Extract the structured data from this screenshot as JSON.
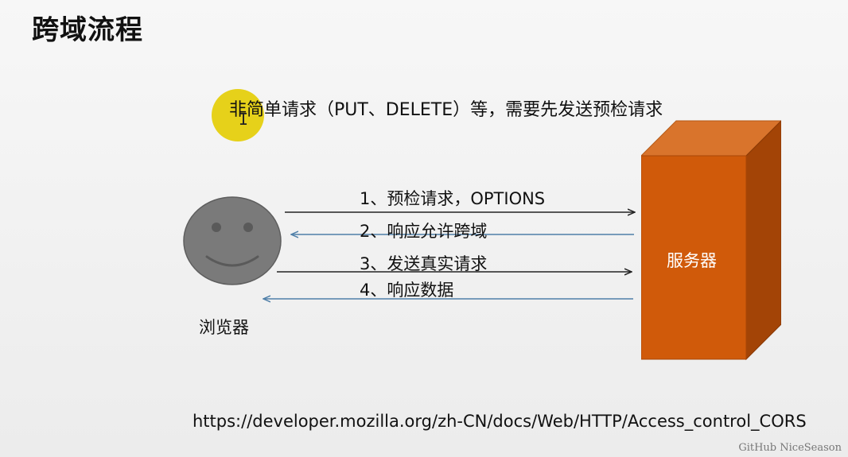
{
  "slide": {
    "title": "跨域流程",
    "subtitle": "非简单请求（PUT、DELETE）等，需要先发送预检请求",
    "cursor_glyph": "I",
    "browser_label": "浏览器",
    "server_label": "服务器",
    "steps": [
      {
        "label": "1、预检请求，OPTIONS",
        "direction": "to-server"
      },
      {
        "label": "2、响应允许跨域",
        "direction": "to-browser"
      },
      {
        "label": "3、发送真实请求",
        "direction": "to-server"
      },
      {
        "label": "4、响应数据",
        "direction": "to-browser"
      }
    ],
    "url": "https://developer.mozilla.org/zh-CN/docs/Web/HTTP/Access_control_CORS",
    "watermark": "GitHub NiceSeason"
  },
  "colors": {
    "server_front": "#d05a0a",
    "server_top": "#d9742c",
    "server_side": "#a34406",
    "face_fill": "#7a7a7a",
    "arrow_request": "#222222",
    "arrow_response": "#4f7fa8",
    "cursor_highlight": "#e5cf0e"
  }
}
